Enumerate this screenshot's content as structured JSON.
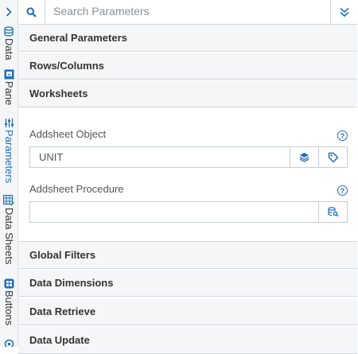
{
  "rail": {
    "expand_icon": "chevron-right-icon",
    "tabs": [
      {
        "label": "Data",
        "icon": "database-icon"
      },
      {
        "label": "Pane",
        "icon": "pane-icon"
      },
      {
        "label": "Parameters",
        "icon": "sliders-icon"
      },
      {
        "label": "Data Sheets",
        "icon": "grid-check-icon"
      },
      {
        "label": "Buttons",
        "icon": "buttons-icon"
      }
    ]
  },
  "search": {
    "placeholder": "Search Parameters",
    "value": ""
  },
  "sections": {
    "general": "General Parameters",
    "rows_columns": "Rows/Columns",
    "worksheets": "Worksheets",
    "global_filters": "Global Filters",
    "data_dimensions": "Data Dimensions",
    "data_retrieve": "Data Retrieve",
    "data_update": "Data Update"
  },
  "worksheets": {
    "addsheet_object": {
      "label": "Addsheet Object",
      "value": "UNIT"
    },
    "addsheet_procedure": {
      "label": "Addsheet Procedure",
      "value": ""
    }
  },
  "colors": {
    "accent": "#1f6fb5",
    "header_bg": "#f4f6f8",
    "border": "#cfd6dc"
  }
}
